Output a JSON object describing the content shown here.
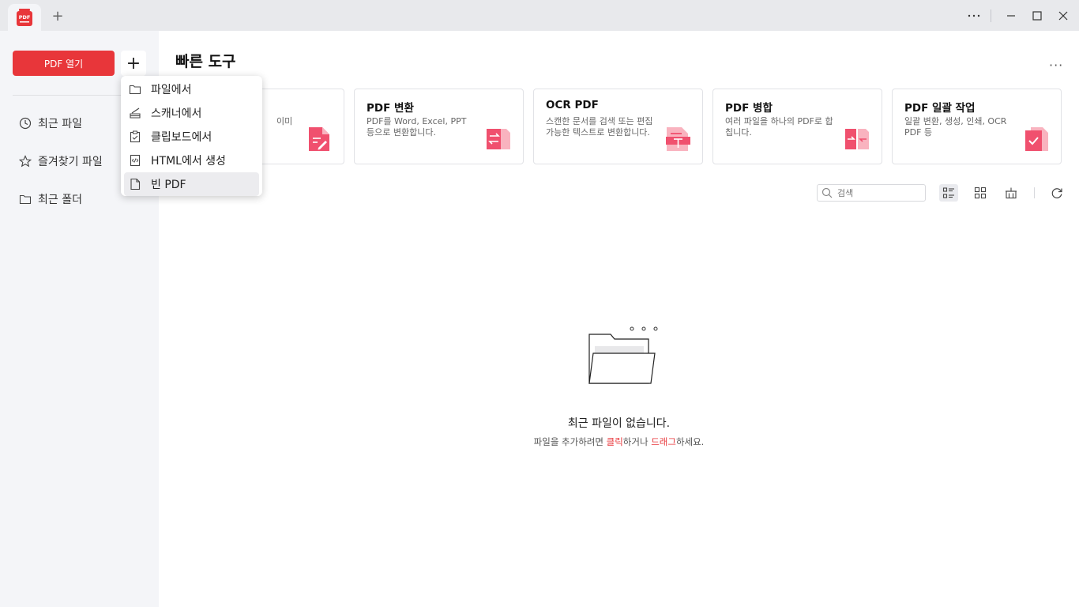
{
  "titlebar": {
    "new_tab_label": "+",
    "controls": [
      "more-icon",
      "minimize-icon",
      "maximize-icon",
      "close-icon"
    ]
  },
  "sidebar": {
    "open_button": "PDF 열기",
    "plus_label": "+",
    "items": [
      {
        "label": "최근 파일",
        "icon": "clock-icon"
      },
      {
        "label": "즐겨찾기 파일",
        "icon": "star-icon"
      },
      {
        "label": "최근 폴더",
        "icon": "folder-icon"
      }
    ]
  },
  "dropdown": {
    "items": [
      {
        "label": "파일에서",
        "icon": "folder-icon"
      },
      {
        "label": "스캐너에서",
        "icon": "scanner-icon"
      },
      {
        "label": "클립보드에서",
        "icon": "clipboard-icon"
      },
      {
        "label": "HTML에서 생성",
        "icon": "html-file-icon"
      },
      {
        "label": "빈 PDF",
        "icon": "blank-page-icon"
      }
    ]
  },
  "quick_tools": {
    "title": "빠른 도구",
    "more_label": "···",
    "cards": [
      {
        "title": "",
        "desc": "이미",
        "icon": "edit-pdf-icon"
      },
      {
        "title": "PDF 변환",
        "desc": "PDF를 Word, Excel, PPT 등으로 변환합니다.",
        "icon": "convert-pdf-icon"
      },
      {
        "title": "OCR PDF",
        "desc": "스캔한 문서를 검색 또는 편집 가능한 텍스트로 변환합니다.",
        "icon": "ocr-pdf-icon"
      },
      {
        "title": "PDF 병합",
        "desc": "여러 파일을 하나의 PDF로 합칩니다.",
        "icon": "merge-pdf-icon"
      },
      {
        "title": "PDF 일괄 작업",
        "desc": "일괄 변환, 생성, 인쇄, OCR PDF 등",
        "icon": "batch-pdf-icon"
      }
    ]
  },
  "recent": {
    "search_placeholder": "검색",
    "empty_title": "최근 파일이 없습니다.",
    "empty_sub_1": "파일을 추가하려면 ",
    "empty_sub_click": "클릭",
    "empty_sub_2": "하거나 ",
    "empty_sub_drag": "드래그",
    "empty_sub_3": "하세요."
  },
  "colors": {
    "accent": "#e8363a",
    "icon_red": "#f0506e",
    "icon_pink": "#f9b3bf"
  }
}
